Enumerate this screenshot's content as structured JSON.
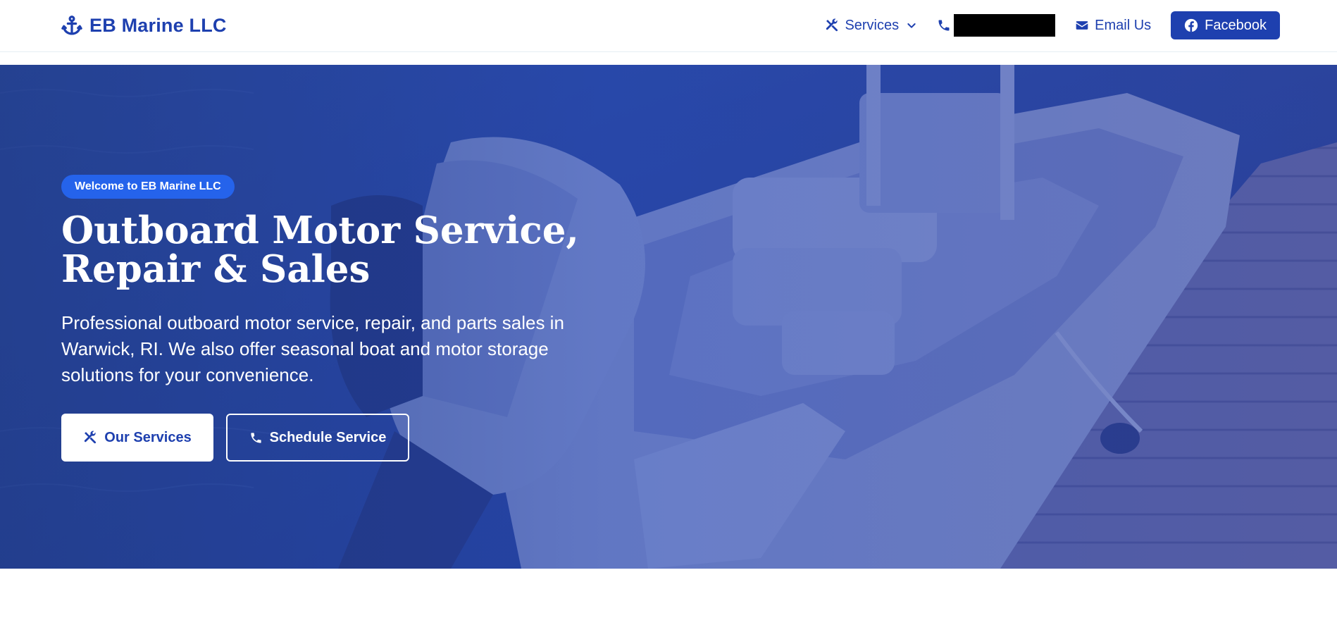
{
  "header": {
    "brand": {
      "icon": "anchor-icon",
      "name": "EB Marine LLC"
    },
    "nav": {
      "services": {
        "icon": "tools-icon",
        "label": "Services",
        "dropdown_icon": "chevron-down-icon"
      },
      "phone": {
        "icon": "phone-icon",
        "number_redacted": true
      },
      "email": {
        "icon": "envelope-icon",
        "label": "Email Us"
      },
      "facebook": {
        "icon": "facebook-icon",
        "label": "Facebook"
      }
    }
  },
  "hero": {
    "badge": "Welcome to EB Marine LLC",
    "title_line1": "Outboard Motor Service,",
    "title_line2": "Repair & Sales",
    "description": "Professional outboard motor service, repair, and parts sales in Warwick, RI. We also offer seasonal boat and motor storage solutions for your convenience.",
    "background_image": "boat-with-outboard-motor-at-dock",
    "buttons": {
      "services": {
        "icon": "tools-icon",
        "label": "Our Services"
      },
      "schedule": {
        "icon": "phone-icon",
        "label": "Schedule Service"
      }
    }
  },
  "colors": {
    "primary": "#1e40af",
    "badge": "#2563eb",
    "overlay": "#1e3a8a",
    "text_light": "#ffffff"
  }
}
